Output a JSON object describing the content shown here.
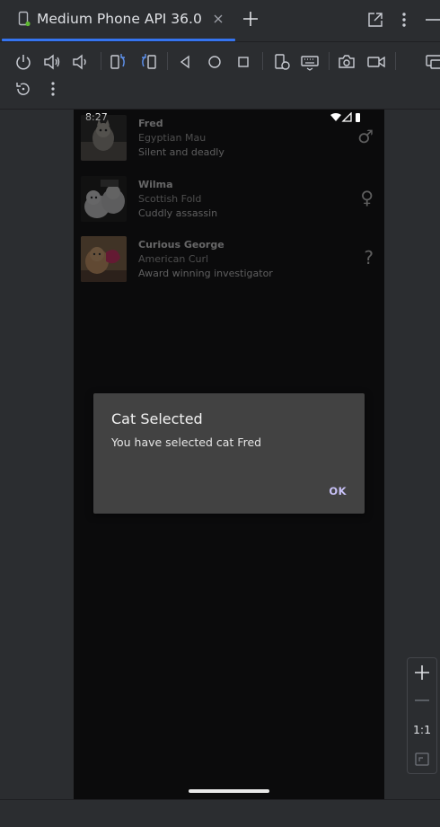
{
  "tab": {
    "title": "Medium Phone API 36.0"
  },
  "icons": {
    "device": "device-icon",
    "close": "close-icon",
    "new_tab": "plus-icon",
    "detach": "open-in-window-icon",
    "more": "more-vertical-icon"
  },
  "toolbar": {
    "tools": [
      "power-icon",
      "volume-up-icon",
      "volume-down-icon",
      "rotate-left-icon",
      "rotate-right-icon",
      "back-icon",
      "home-icon",
      "overview-icon",
      "device-settings-icon",
      "keyboard-icon",
      "screenshot-icon",
      "screen-record-icon",
      "multi-display-icon",
      "reset-icon",
      "more-icon"
    ]
  },
  "phone": {
    "status": {
      "time": "8:27"
    },
    "cats": [
      {
        "name": "Fred",
        "breed": "Egyptian Mau",
        "bio": "Silent and deadly",
        "gender": "♂"
      },
      {
        "name": "Wilma",
        "breed": "Scottish Fold",
        "bio": "Cuddly assassin",
        "gender": "♀"
      },
      {
        "name": "Curious George",
        "breed": "American Curl",
        "bio": "Award winning investigator",
        "gender": "?"
      }
    ],
    "dialog": {
      "title": "Cat Selected",
      "message": "You have selected cat Fred",
      "ok_label": "OK"
    }
  },
  "zoom": {
    "label": "1:1"
  },
  "colors": {
    "accent": "#3574f0",
    "dialog_bg": "#424242",
    "ok_text": "#c9c2f8"
  }
}
